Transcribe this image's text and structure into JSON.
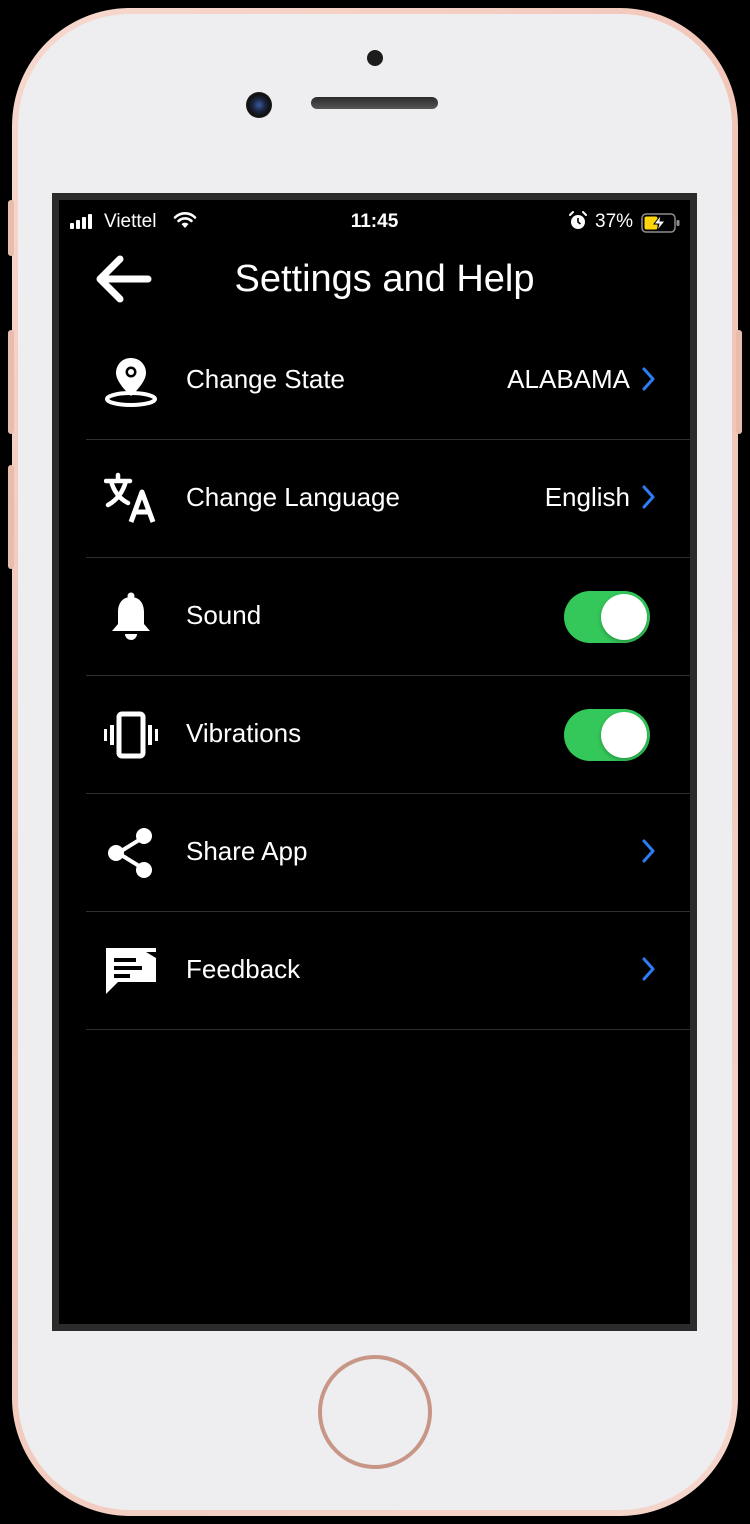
{
  "status_bar": {
    "carrier": "Viettel",
    "time": "11:45",
    "battery_percent": "37%"
  },
  "header": {
    "title": "Settings and Help"
  },
  "settings": {
    "items": [
      {
        "label": "Change State",
        "value": "ALABAMA",
        "icon": "location-pin-icon",
        "control": "chevron"
      },
      {
        "label": "Change Language",
        "value": "English",
        "icon": "translate-icon",
        "control": "chevron"
      },
      {
        "label": "Sound",
        "icon": "bell-icon",
        "control": "toggle",
        "on": true
      },
      {
        "label": "Vibrations",
        "icon": "vibration-icon",
        "control": "toggle",
        "on": true
      },
      {
        "label": "Share App",
        "icon": "share-icon",
        "control": "chevron"
      },
      {
        "label": "Feedback",
        "icon": "feedback-icon",
        "control": "chevron"
      }
    ]
  },
  "colors": {
    "toggle_on": "#34c759",
    "chevron": "#2f7df6",
    "background": "#000000",
    "text": "#ffffff"
  }
}
